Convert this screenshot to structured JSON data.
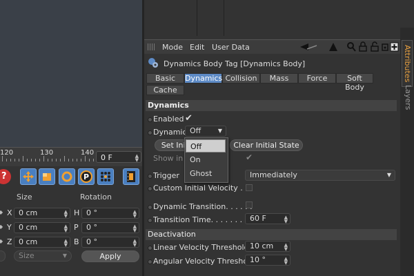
{
  "timeline": {
    "ruler_labels": [
      "120",
      "130",
      "140"
    ],
    "current_frame": "0 F"
  },
  "coordinates": {
    "size_header": "Size",
    "rotation_header": "Rotation",
    "rows": [
      {
        "pos_axis": "X",
        "size_value": "0 cm",
        "rot_axis": "H",
        "rot_value": "0 °"
      },
      {
        "pos_axis": "Y",
        "size_value": "0 cm",
        "rot_axis": "P",
        "rot_value": "0 °"
      },
      {
        "pos_axis": "Z",
        "size_value": "0 cm",
        "rot_axis": "B",
        "rot_value": "0 °"
      }
    ],
    "size_mode": "Size",
    "apply_label": "Apply"
  },
  "attributes": {
    "menu": [
      "Mode",
      "Edit",
      "User Data"
    ],
    "tag_title": "Dynamics Body Tag [Dynamics Body]",
    "tabs": [
      "Basic",
      "Dynamics",
      "Collision",
      "Mass",
      "Force",
      "Soft Body",
      "Cache"
    ],
    "active_tab": "Dynamics",
    "section_dynamics": "Dynamics",
    "enabled_label": "Enabled",
    "enabled_check": "✔",
    "dynamic_label": "Dynamic",
    "dynamic_value": "Off",
    "set_initial_label": "Set Initial State",
    "clear_initial_label": "Clear Initial State",
    "show_in_viewport_label": "Show in Viewport",
    "show_in_viewport_check": "✔",
    "trigger_label": "Trigger",
    "trigger_value": "Immediately",
    "custom_velocity_label": "Custom Initial Velocity . . .",
    "dynamic_transition_label": "Dynamic Transition. . . . . .",
    "transition_time_label": "Transition Time. . . . . . . . .",
    "transition_time_value": "60 F",
    "section_deactivation": "Deactivation",
    "linear_threshold_label": "Linear Velocity Threshold",
    "linear_threshold_value": "10 cm",
    "angular_threshold_label": "Angular Velocity Threshold",
    "angular_threshold_value": "10 °"
  },
  "side_tabs": [
    "Attributes",
    "Layers"
  ],
  "dropdown_options": [
    "Off",
    "On",
    "Ghost"
  ],
  "dropdown_selected": "Off",
  "colors": {
    "accent": "#5e8bc6",
    "side_tab_active": "#e8a040"
  }
}
